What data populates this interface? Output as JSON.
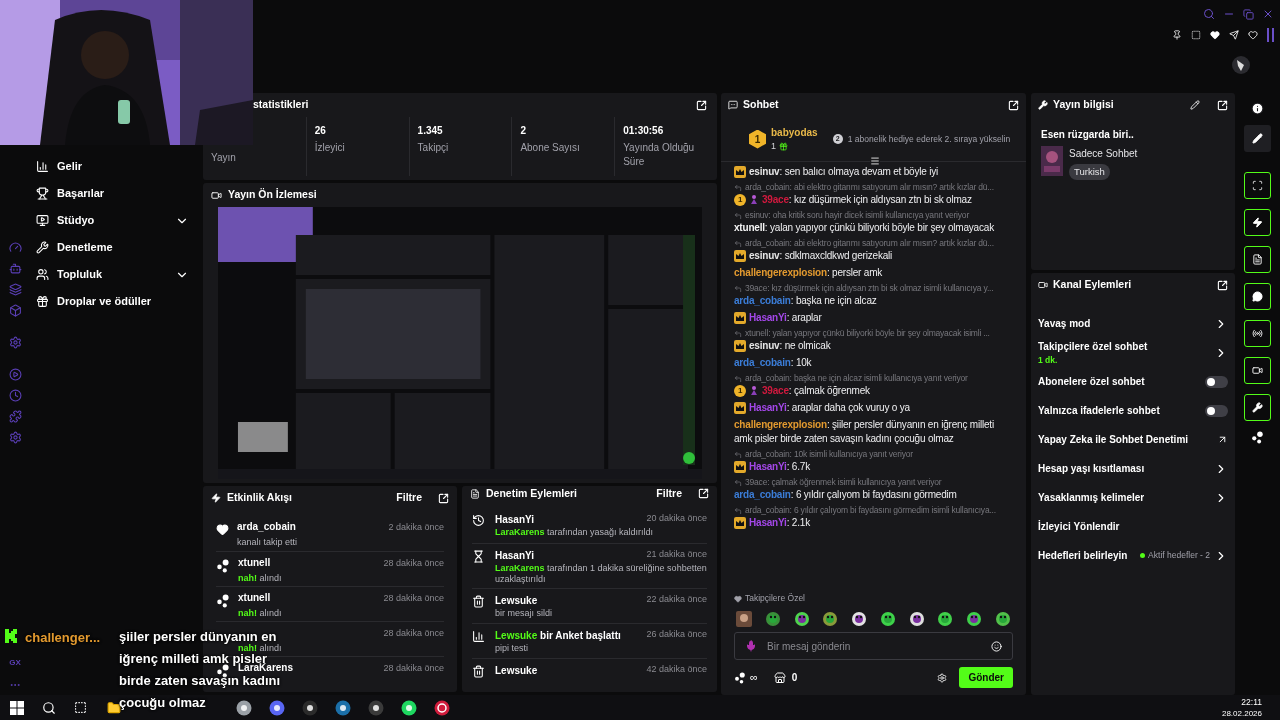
{
  "sidebar": {
    "items": [
      {
        "label": "Gelir",
        "kind": "link"
      },
      {
        "label": "Başarılar",
        "kind": "link"
      },
      {
        "label": "Stüdyo",
        "kind": "group",
        "expanded": false
      },
      {
        "label": "Denetleme",
        "kind": "link"
      },
      {
        "label": "Topluluk",
        "kind": "group",
        "expanded": false
      },
      {
        "label": "Droplar ve ödüller",
        "kind": "link"
      }
    ],
    "gx_label": "GX"
  },
  "stats": {
    "title": "statistikleri",
    "items": [
      {
        "label": "Yayın"
      },
      {
        "value": "26",
        "label": "İzleyici"
      },
      {
        "value": "1.345",
        "label": "Takipçi"
      },
      {
        "value": "2",
        "label": "Abone Sayısı"
      },
      {
        "value": "01:30:56",
        "label": "Yayında Olduğu Süre"
      }
    ]
  },
  "preview": {
    "title": "Yayın Ön İzlemesi"
  },
  "activity": {
    "title": "Etkinlik Akışı",
    "filter": "Filtre",
    "events": [
      {
        "kind": "follow",
        "user": "arda_cobain",
        "detail": [
          {
            "text": "kanalı takip etti",
            "highlight": false
          }
        ],
        "time": "2 dakika önce"
      },
      {
        "kind": "reward",
        "user": "xtunell",
        "detail": [
          {
            "text": "nah!",
            "highlight": true
          },
          {
            "text": "alındı",
            "highlight": false
          }
        ],
        "time": "28 dakika önce"
      },
      {
        "kind": "reward",
        "user": "xtunell",
        "detail": [
          {
            "text": "nah!",
            "highlight": true
          },
          {
            "text": "alındı",
            "highlight": false
          }
        ],
        "time": "28 dakika önce"
      },
      {
        "detail": [
          {
            "text": "nah!",
            "highlight": true
          },
          {
            "text": "alındı",
            "highlight": false
          }
        ],
        "time": "28 dakika önce"
      },
      {
        "kind": "reward",
        "user": "LaraKarens",
        "time": "28 dakika önce"
      }
    ]
  },
  "moderation": {
    "title": "Denetim Eylemleri",
    "filter": "Filtre",
    "actions": [
      {
        "kind": "unban",
        "heading": [
          {
            "text": "HasanYi",
            "highlight": false
          }
        ],
        "detail": [
          {
            "text": "LaraKarens",
            "highlight": true
          },
          {
            "text": "tarafından yasağı kaldırıldı",
            "highlight": false
          }
        ],
        "time": "20 dakika önce"
      },
      {
        "kind": "timeout",
        "heading": [
          {
            "text": "HasanYi",
            "highlight": false
          }
        ],
        "detail": [
          {
            "text": "LaraKarens",
            "highlight": true
          },
          {
            "text": "tarafından 1 dakika süreliğine sohbetten uzaklaştırıldı",
            "highlight": false
          }
        ],
        "time": "21 dakika önce"
      },
      {
        "kind": "delete",
        "heading": [
          {
            "text": "Lewsuke",
            "highlight": false
          }
        ],
        "detail": [
          {
            "text": "bir mesajı sildi",
            "highlight": false
          }
        ],
        "time": "22 dakika önce"
      },
      {
        "kind": "poll",
        "heading": [
          {
            "text": "Lewsuke",
            "highlight": true
          },
          {
            "text": "bir Anket başlattı",
            "highlight": false
          }
        ],
        "detail": [
          {
            "text": "pipi testi",
            "highlight": false
          }
        ],
        "time": "26 dakika önce"
      },
      {
        "kind": "delete",
        "heading": [
          {
            "text": "Lewsuke",
            "highlight": false
          }
        ],
        "time": "42 dakika önce"
      }
    ]
  },
  "chat": {
    "title": "Sohbet",
    "pinned": {
      "rank": "1",
      "user": "babyodas",
      "count": "1",
      "next_rank": "2",
      "prompt": "1 abonelik hediye ederek 2. sıraya yükselin"
    },
    "messages": [
      {
        "badges": [
          {
            "kind": "crown"
          }
        ],
        "user": "esinuv",
        "color": "#e5e5e5",
        "text": ": sen balıcı olmaya devam et böyle iyi"
      },
      {
        "reply": "arda_cobain: abi elektro gitarımı satıyorum alır mısın? artık kızlar dü...",
        "badges": [
          {
            "kind": "rank",
            "text": "1"
          },
          {
            "kind": "figure"
          }
        ],
        "user": "39ace",
        "color": "#d1193e",
        "text": ": kız düşürmek için aldıysan ztn bi sk olmaz"
      },
      {
        "reply": "esinuv: oha kritik soru hayir dicek isimli kullanıcıya yanıt veriyor",
        "user": "xtunell",
        "color": "#f5f5f5",
        "text": ": yalan yapıyor çünkü biliyorki böyle bir şey olmayacak"
      },
      {
        "reply": "arda_cobain: abi elektro gitarımı satıyorum alır mısın? artık kızlar dü...",
        "badges": [
          {
            "kind": "crown"
          }
        ],
        "user": "esinuv",
        "color": "#e5e5e5",
        "text": ": sdklmaxcldkwd gerizekali"
      },
      {
        "user": "challengerexplosion",
        "color": "#e39a2f",
        "text": ": persler amk"
      },
      {
        "reply": "39ace: kız düşürmek için aldıysan ztn bi sk olmaz isimli kullanıcıya y...",
        "user": "arda_cobain",
        "color": "#3b7dd8",
        "text": ": başka ne için alcaz"
      },
      {
        "badges": [
          {
            "kind": "crown"
          }
        ],
        "user": "HasanYi",
        "color": "#a347e8",
        "text": ": araplar"
      },
      {
        "reply": "xtunell: yalan yapıyor çünkü biliyorki böyle bir şey olmayacak isimli ...",
        "badges": [
          {
            "kind": "crown"
          }
        ],
        "user": "esinuv",
        "color": "#e5e5e5",
        "text": ": ne olmicak"
      },
      {
        "user": "arda_cobain",
        "color": "#3b7dd8",
        "text": ": 10k"
      },
      {
        "reply": "arda_cobain: başka ne için alcaz isimli kullanıcıya yanıt veriyor",
        "badges": [
          {
            "kind": "rank",
            "text": "1"
          },
          {
            "kind": "figure"
          }
        ],
        "user": "39ace",
        "color": "#d1193e",
        "text": ": çalmak öğrenmek"
      },
      {
        "badges": [
          {
            "kind": "crown"
          }
        ],
        "user": "HasanYi",
        "color": "#a347e8",
        "text": ": araplar daha çok vuruy o ya"
      },
      {
        "user": "challengerexplosion",
        "color": "#e39a2f",
        "text": ": şiiler persler dünyanın en iğrenç milleti amk pisler birde zaten savaşın kadını çocuğu olmaz"
      },
      {
        "reply": "arda_cobain: 10k isimli kullanıcıya yanıt veriyor",
        "badges": [
          {
            "kind": "crown"
          }
        ],
        "user": "HasanYi",
        "color": "#a347e8",
        "text": ": 6.7k"
      },
      {
        "reply": "39ace: çalmak öğrenmek isimli kullanıcıya yanıt veriyor",
        "user": "arda_cobain",
        "color": "#3b7dd8",
        "text": ": 6 yıldır çalıyom bi faydasını görmedim"
      },
      {
        "reply": "arda_cobain: 6 yıldır çalıyom bi faydasını görmedim isimli kullanıcıya...",
        "badges": [
          {
            "kind": "crown"
          }
        ],
        "user": "HasanYi",
        "color": "#a347e8",
        "text": ": 2.1k"
      }
    ],
    "emote_section": "Takipçilere Özel",
    "input": {
      "placeholder": "Bir mesaj gönderin"
    },
    "points": "∞",
    "store_count": "0",
    "send": "Gönder"
  },
  "stream_info": {
    "title": "Yayın bilgisi",
    "stream_title": "Esen rüzgarda biri..",
    "category": "Sadece Sohbet",
    "tag": "Turkish"
  },
  "channel_actions": {
    "title": "Kanal Eylemleri",
    "items": [
      {
        "kind": "arrow",
        "label": "Yavaş mod"
      },
      {
        "kind": "arrow",
        "label": "Takipçilere özel sohbet",
        "sub": "1 dk."
      },
      {
        "kind": "toggle",
        "label": "Abonelere özel sohbet",
        "on": false
      },
      {
        "kind": "toggle",
        "label": "Yalnızca ifadelerle sohbet",
        "on": false
      },
      {
        "kind": "external",
        "label": "Yapay Zeka ile Sohbet Denetimi"
      },
      {
        "kind": "arrow",
        "label": "Hesap yaşı kısıtlaması"
      },
      {
        "kind": "arrow",
        "label": "Yasaklanmış kelimeler"
      },
      {
        "kind": "plain",
        "label": "İzleyici Yönlendir"
      },
      {
        "kind": "arrow",
        "label": "Hedefleri belirleyin",
        "status": "Aktif hedefler - 2"
      }
    ]
  },
  "overlay": {
    "user": "challenger...",
    "lines": [
      "şiiler persler dünyanın en",
      "iğrenç milleti amk pisler",
      "birde zaten savaşın kadını",
      "çocuğu olmaz"
    ]
  },
  "taskbar": {
    "time": "22:11",
    "date": "28.02.2026"
  }
}
